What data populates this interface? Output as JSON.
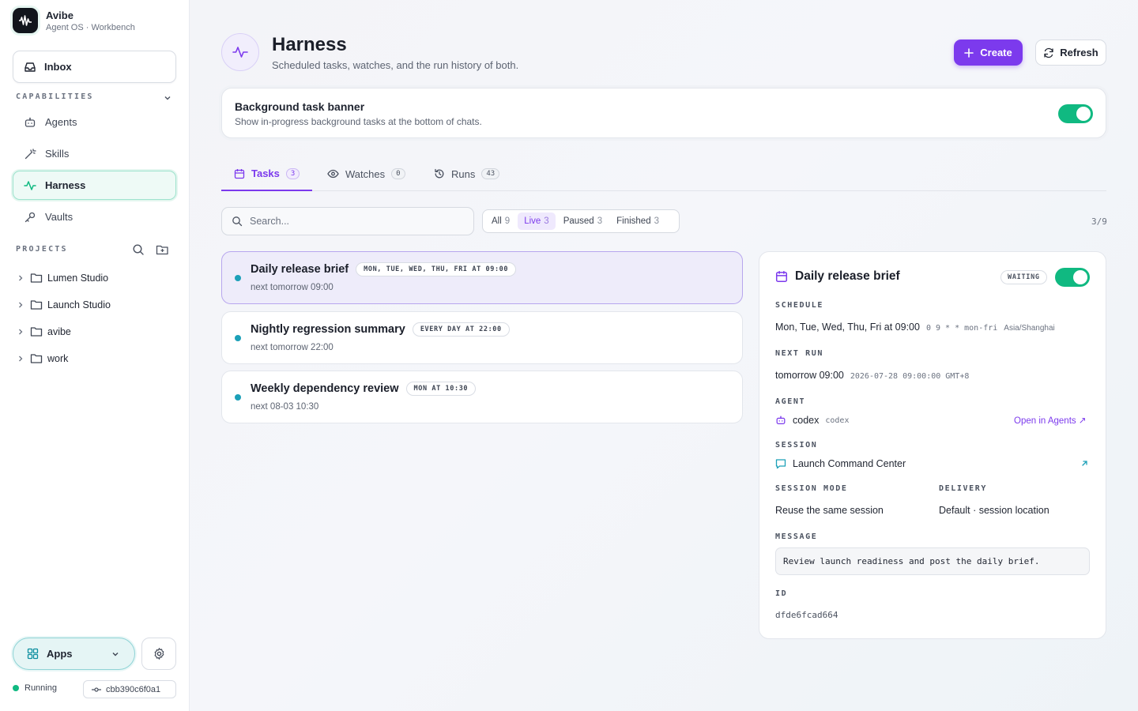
{
  "brand": {
    "name": "Avibe",
    "subtitle": "Agent OS · Workbench"
  },
  "sidebar": {
    "inbox_label": "Inbox",
    "capabilities_label": "CAPABILITIES",
    "nav": [
      {
        "label": "Agents",
        "icon": "robot-icon"
      },
      {
        "label": "Skills",
        "icon": "wand-icon"
      },
      {
        "label": "Harness",
        "icon": "pulse-icon",
        "active": true
      },
      {
        "label": "Vaults",
        "icon": "key-icon"
      }
    ],
    "projects_label": "PROJECTS",
    "projects": [
      "Lumen Studio",
      "Launch Studio",
      "avibe",
      "work"
    ],
    "apps_label": "Apps",
    "status_label": "Running",
    "commit": "cbb390c6f0a1"
  },
  "header": {
    "title": "Harness",
    "subtitle": "Scheduled tasks, watches, and the run history of both.",
    "create_label": "Create",
    "refresh_label": "Refresh"
  },
  "banner": {
    "title": "Background task banner",
    "description": "Show in-progress background tasks at the bottom of chats.",
    "enabled": true
  },
  "tabs": [
    {
      "label": "Tasks",
      "count": "3",
      "active": true
    },
    {
      "label": "Watches",
      "count": "0"
    },
    {
      "label": "Runs",
      "count": "43"
    }
  ],
  "search": {
    "placeholder": "Search..."
  },
  "filters": [
    {
      "label": "All",
      "count": "9"
    },
    {
      "label": "Live",
      "count": "3",
      "active": true
    },
    {
      "label": "Paused",
      "count": "3"
    },
    {
      "label": "Finished",
      "count": "3"
    }
  ],
  "result_count": "3/9",
  "tasks": [
    {
      "title": "Daily release brief",
      "schedule": "MON, TUE, WED, THU, FRI AT 09:00",
      "next": "next tomorrow 09:00"
    },
    {
      "title": "Nightly regression summary",
      "schedule": "EVERY DAY AT 22:00",
      "next": "next tomorrow 22:00"
    },
    {
      "title": "Weekly dependency review",
      "schedule": "MON AT 10:30",
      "next": "next 08-03 10:30"
    }
  ],
  "detail": {
    "title": "Daily release brief",
    "status": "WAITING",
    "enabled": true,
    "schedule_label": "SCHEDULE",
    "schedule": "Mon, Tue, Wed, Thu, Fri at 09:00",
    "cron": "0 9 * * mon-fri",
    "timezone": "Asia/Shanghai",
    "next_run_label": "NEXT RUN",
    "next_run": "tomorrow 09:00",
    "next_run_exact": "2026-07-28 09:00:00 GMT+8",
    "agent_label": "AGENT",
    "agent": "codex",
    "agent_id": "codex",
    "open_agents_label": "Open in Agents ↗",
    "session_label": "SESSION",
    "session": "Launch Command Center",
    "session_mode_label": "SESSION MODE",
    "session_mode": "Reuse the same session",
    "delivery_label": "DELIVERY",
    "delivery": "Default · session location",
    "message_label": "MESSAGE",
    "message": "Review launch readiness and post the daily brief.",
    "id_label": "ID",
    "id": "dfde6fcad664"
  },
  "colors": {
    "accent": "#7c3aed",
    "success": "#10b981",
    "teal": "#1ca0b8"
  }
}
